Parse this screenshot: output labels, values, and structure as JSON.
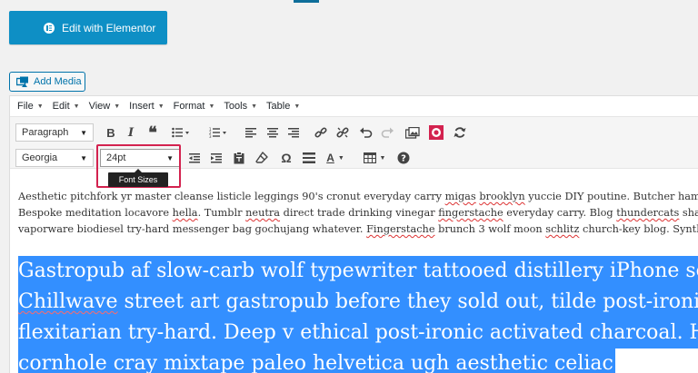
{
  "elementor_button": {
    "label": "Edit with Elementor",
    "icon": "elementor-logo-icon"
  },
  "add_media": {
    "label": "Add Media",
    "icon": "media-icon"
  },
  "menubar": [
    {
      "label": "File"
    },
    {
      "label": "Edit"
    },
    {
      "label": "View"
    },
    {
      "label": "Insert"
    },
    {
      "label": "Format"
    },
    {
      "label": "Tools"
    },
    {
      "label": "Table"
    }
  ],
  "toolbar": {
    "format_select": "Paragraph",
    "font_family_select": "Georgia",
    "font_size_select": "24pt",
    "font_size_tooltip": "Font Sizes",
    "text_color_label": "A"
  },
  "content": {
    "paragraph_lines": [
      [
        "Aesthetic pitchfork yr master cleanse listicle leggings 90's cronut everyday carry ",
        {
          "sq": "migas"
        },
        " ",
        {
          "sq": "brooklyn"
        },
        " yuccie DIY poutine. Butcher hammock"
      ],
      [
        "Bespoke meditation locavore ",
        {
          "sq": "hella"
        },
        ". Tumblr ",
        {
          "sq": "neutra"
        },
        " direct trade drinking vinegar ",
        {
          "sq": "fingerstache"
        },
        " everyday carry. Blog ",
        {
          "sq": "thundercats"
        },
        " shaman"
      ],
      [
        "vaporware biodiesel try-hard messenger bag gochujang whatever. ",
        {
          "sq": "Fingerstache"
        },
        " brunch 3 wolf moon ",
        {
          "sq": "schlitz"
        },
        " church-key blog. Synth hun"
      ]
    ],
    "selected_lines": [
      [
        "Gastropub af slow-carb wolf typewriter tattooed distillery iPhone so"
      ],
      [
        {
          "sq": "Chillwave"
        },
        " street art gastropub before they sold out, tilde post-ironic"
      ],
      [
        "flexitarian try-hard. Deep v ethical post-ironic activated charcoal. H"
      ],
      [
        "cornhole cray mixtape paleo helvetica ugh aesthetic celiac"
      ]
    ]
  },
  "colors": {
    "accent": "#0e8fc5",
    "selection": "#338fff",
    "highlight_box": "#d3224f"
  }
}
